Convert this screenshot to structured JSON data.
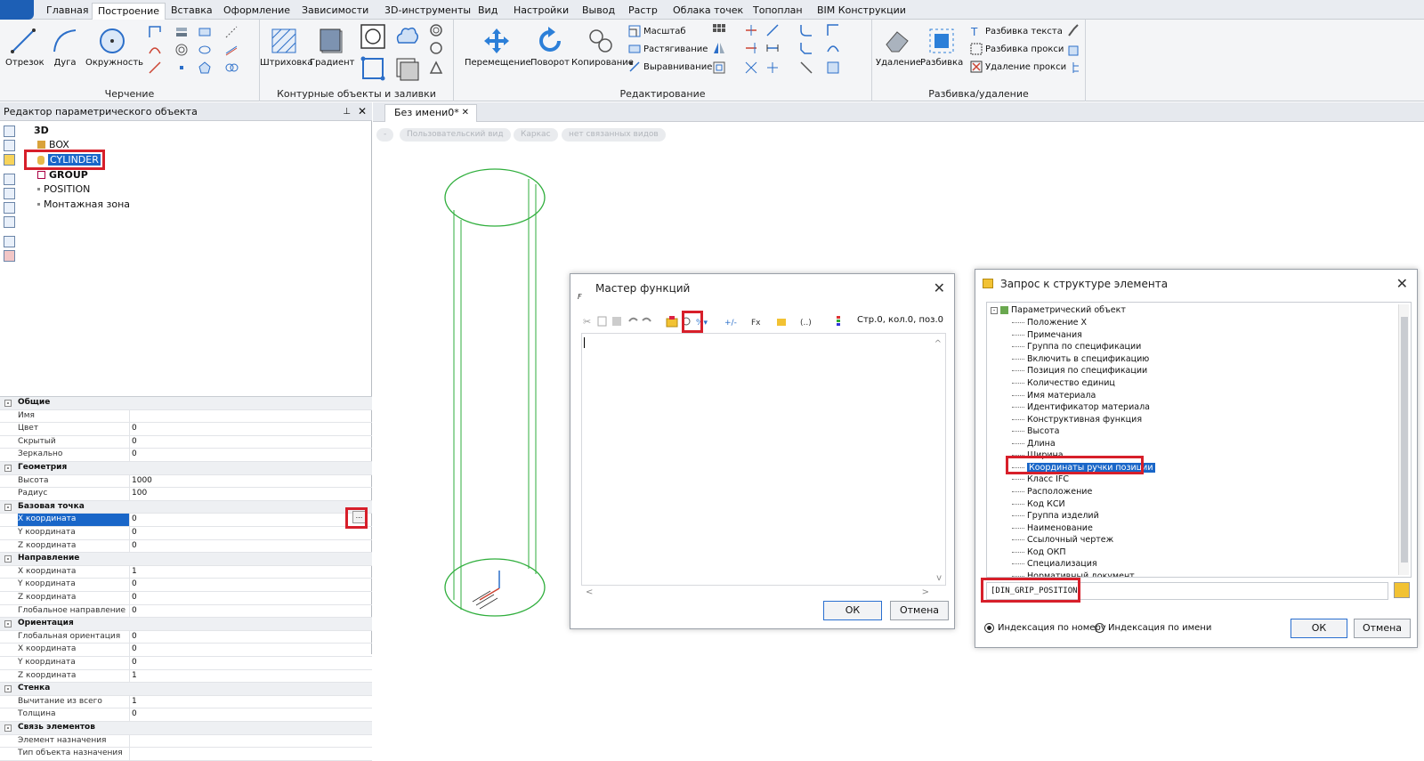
{
  "menu_tabs": [
    "Главная",
    "Построение",
    "Вставка",
    "Оформление",
    "Зависимости",
    "3D-инструменты",
    "Вид",
    "Настройки",
    "Вывод",
    "Растр",
    "Облака точек",
    "Топоплан",
    "BIM Конструкции"
  ],
  "active_tab": "Построение",
  "ribbon": {
    "drawing": {
      "title": "Черчение",
      "line": "Отрезок",
      "arc": "Дуга",
      "circle": "Окружность"
    },
    "contours": {
      "title": "Контурные объекты и заливки",
      "hatch": "Штриховка",
      "gradient": "Градиент"
    },
    "edit": {
      "title": "Редактирование",
      "move": "Перемещение",
      "rotate": "Поворот",
      "copy": "Копирование",
      "scale": "Масштаб",
      "stretch": "Растягивание",
      "align": "Выравнивание"
    },
    "explode": {
      "title": "Разбивка/удаление",
      "delete": "Удаление",
      "explode": "Разбивка",
      "explode_text": "Разбивка текста",
      "explode_proxy": "Разбивка прокси",
      "delete_proxy": "Удаление прокси"
    }
  },
  "left_panel": {
    "title": "Редактор параметрического объекта",
    "tree": [
      "3D",
      "BOX",
      "CYLINDER",
      "GROUP",
      "POSITION",
      "Монтажная зона"
    ],
    "properties": [
      {
        "cat": "Общие"
      },
      {
        "name": "Имя",
        "value": ""
      },
      {
        "name": "Цвет",
        "value": "0"
      },
      {
        "name": "Скрытый",
        "value": "0"
      },
      {
        "name": "Зеркально",
        "value": "0"
      },
      {
        "cat": "Геометрия"
      },
      {
        "name": "Высота",
        "value": "1000"
      },
      {
        "name": "Радиус",
        "value": "100"
      },
      {
        "cat": "Базовая точка"
      },
      {
        "name": "X координата",
        "value": "0",
        "selected": true
      },
      {
        "name": "Y координата",
        "value": "0"
      },
      {
        "name": "Z координата",
        "value": "0"
      },
      {
        "cat": "Направление"
      },
      {
        "name": "X координата",
        "value": "1"
      },
      {
        "name": "Y координата",
        "value": "0"
      },
      {
        "name": "Z координата",
        "value": "0"
      },
      {
        "name": "Глобальное направление",
        "value": "0"
      },
      {
        "cat": "Ориентация"
      },
      {
        "name": "Глобальная ориентация",
        "value": "0"
      },
      {
        "name": "X координата",
        "value": "0"
      },
      {
        "name": "Y координата",
        "value": "0"
      },
      {
        "name": "Z координата",
        "value": "1"
      },
      {
        "cat": "Стенка"
      },
      {
        "name": "Вычитание из всего",
        "value": "1"
      },
      {
        "name": "Толщина",
        "value": "0"
      },
      {
        "cat": "Связь элементов"
      },
      {
        "name": "Элемент назначения",
        "value": ""
      },
      {
        "name": "Тип объекта назначения",
        "value": ""
      }
    ],
    "ellipsis": "..."
  },
  "document": {
    "tab": "Без имени0*",
    "close": "✕",
    "view_pills": [
      "-",
      "Пользовательский вид",
      "Каркас",
      "нет связанных видов"
    ]
  },
  "function_wizard": {
    "title": "Мастер функций",
    "status": "Стр.0, кол.0, поз.0",
    "ok": "ОК",
    "cancel": "Отмена"
  },
  "structure_query": {
    "title": "Запрос к структуре элемента",
    "root": "Параметрический объект",
    "items": [
      "Положение X",
      "Примечания",
      "Группа по спецификации",
      "Включить в спецификацию",
      "Позиция по спецификации",
      "Количество единиц",
      "Имя материала",
      "Идентификатор материала",
      "Конструктивная функция",
      "Высота",
      "Длина",
      "Ширина",
      "Координаты ручки позиции",
      "Класс IFC",
      "Расположение",
      "Код КСИ",
      "Группа изделий",
      "Наименование",
      "Ссылочный чертеж",
      "Код ОКП",
      "Специализация",
      "Нормативный документ"
    ],
    "selected_item": "Координаты ручки позиции",
    "expression": "[DIN_GRIP_POSITION]",
    "radio_number": "Индексация по номеру",
    "radio_name": "Индексация по имени",
    "ok": "ОК",
    "cancel": "Отмена"
  },
  "colors": {
    "accent": "#1966c8",
    "highlight": "#d71f2a",
    "wire": "#2fae3c"
  }
}
